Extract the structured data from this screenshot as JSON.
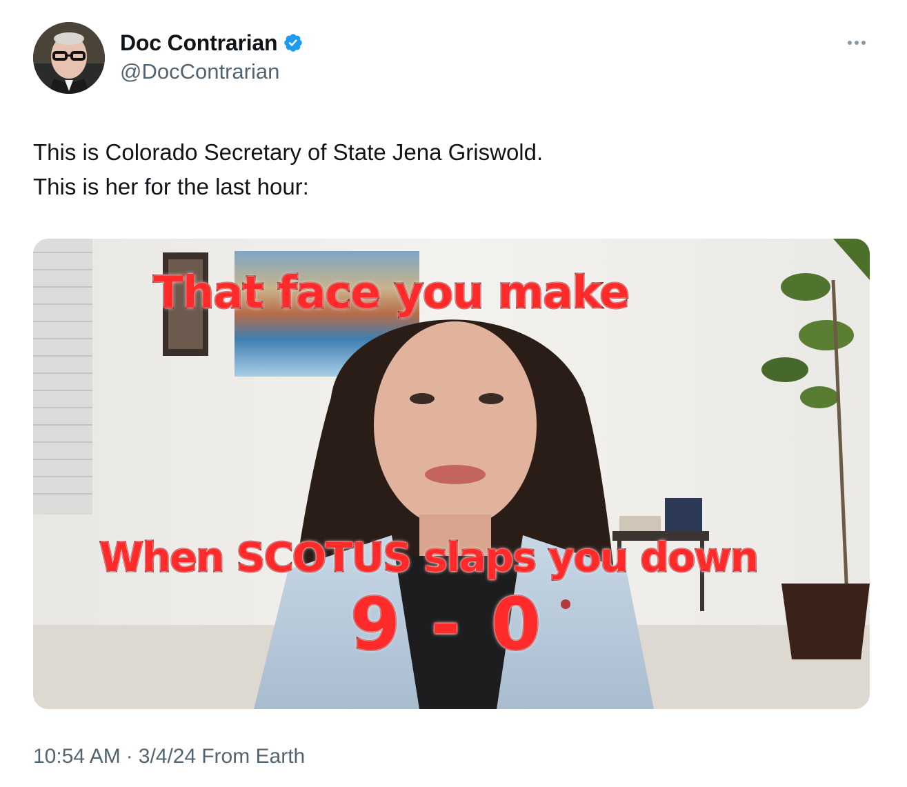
{
  "author": {
    "display_name": "Doc Contrarian",
    "handle": "@DocContrarian",
    "verified": true
  },
  "tweet": {
    "text_line_1": "This is Colorado Secretary of State Jena Griswold.",
    "text_line_2": "This is her for the last hour:"
  },
  "media": {
    "caption_top": "That face you make",
    "caption_bottom": "When SCOTUS slaps you down",
    "caption_score": "9 - 0"
  },
  "meta": {
    "time": "10:54 AM",
    "separator": "·",
    "date": "3/4/24",
    "source": "From Earth"
  },
  "colors": {
    "text_primary": "#0f1419",
    "text_secondary": "#536471",
    "verified_badge": "#1d9bf0",
    "caption_fill": "#ff2b2b",
    "caption_stroke": "#8e0000"
  },
  "icons": {
    "verified": "verified-badge-icon",
    "more": "more-options-icon"
  }
}
